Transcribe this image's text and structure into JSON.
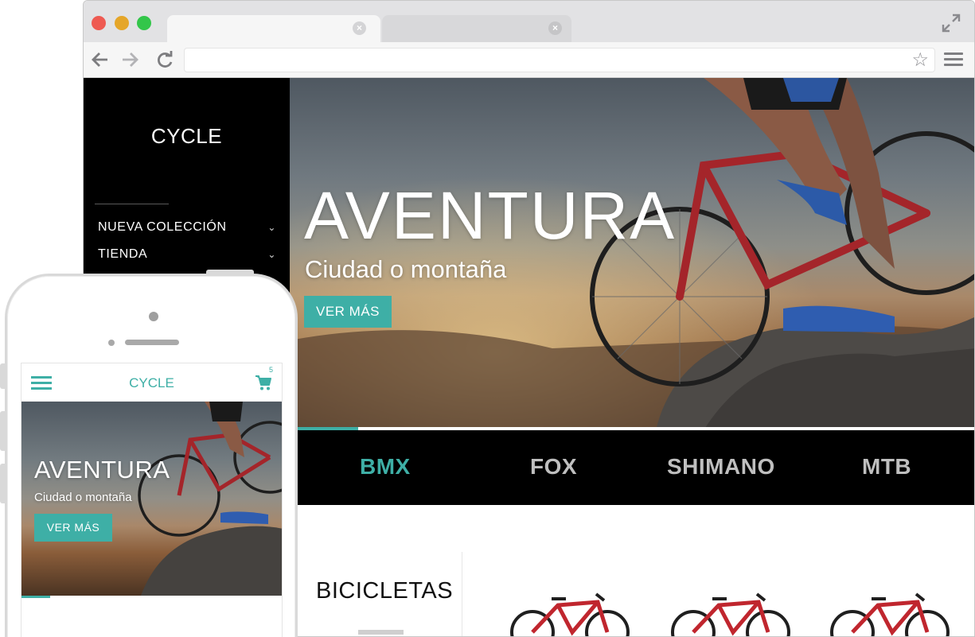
{
  "browser": {
    "address": {
      "value": "",
      "placeholder": ""
    },
    "tabs": [
      {
        "label": ""
      },
      {
        "label": ""
      }
    ]
  },
  "desktop": {
    "logo": "CYCLE",
    "nav": [
      {
        "label": "NUEVA COLECCIÓN"
      },
      {
        "label": "TIENDA"
      }
    ],
    "hero": {
      "title": "AVENTURA",
      "subtitle": "Ciudad o montaña",
      "button": "VER MÁS",
      "slide_progress": 0.1
    },
    "brands": [
      {
        "label": "BMX",
        "active": true
      },
      {
        "label": "FOX",
        "active": false
      },
      {
        "label": "SHIMANO",
        "active": false
      },
      {
        "label": "MTB",
        "active": false
      }
    ],
    "category": {
      "title": "BICICLETAS"
    }
  },
  "mobile": {
    "logo": "CYCLE",
    "cart_count": "5",
    "hero": {
      "title": "AVENTURA",
      "subtitle": "Ciudad o montaña",
      "button": "VER MÁS",
      "slide_progress": 0.11
    }
  },
  "colors": {
    "accent": "#3eafa6",
    "sidebar_bg": "#000000",
    "brandbar_bg": "#000000",
    "inactive_brand": "#bfbfbf"
  },
  "icons": {
    "browser": [
      "close-icon",
      "expand-icon",
      "back-arrow-icon",
      "forward-arrow-icon",
      "reload-icon",
      "star-icon",
      "menu-icon"
    ],
    "site": [
      "chevron-down-icon",
      "hamburger-icon",
      "cart-icon"
    ]
  }
}
